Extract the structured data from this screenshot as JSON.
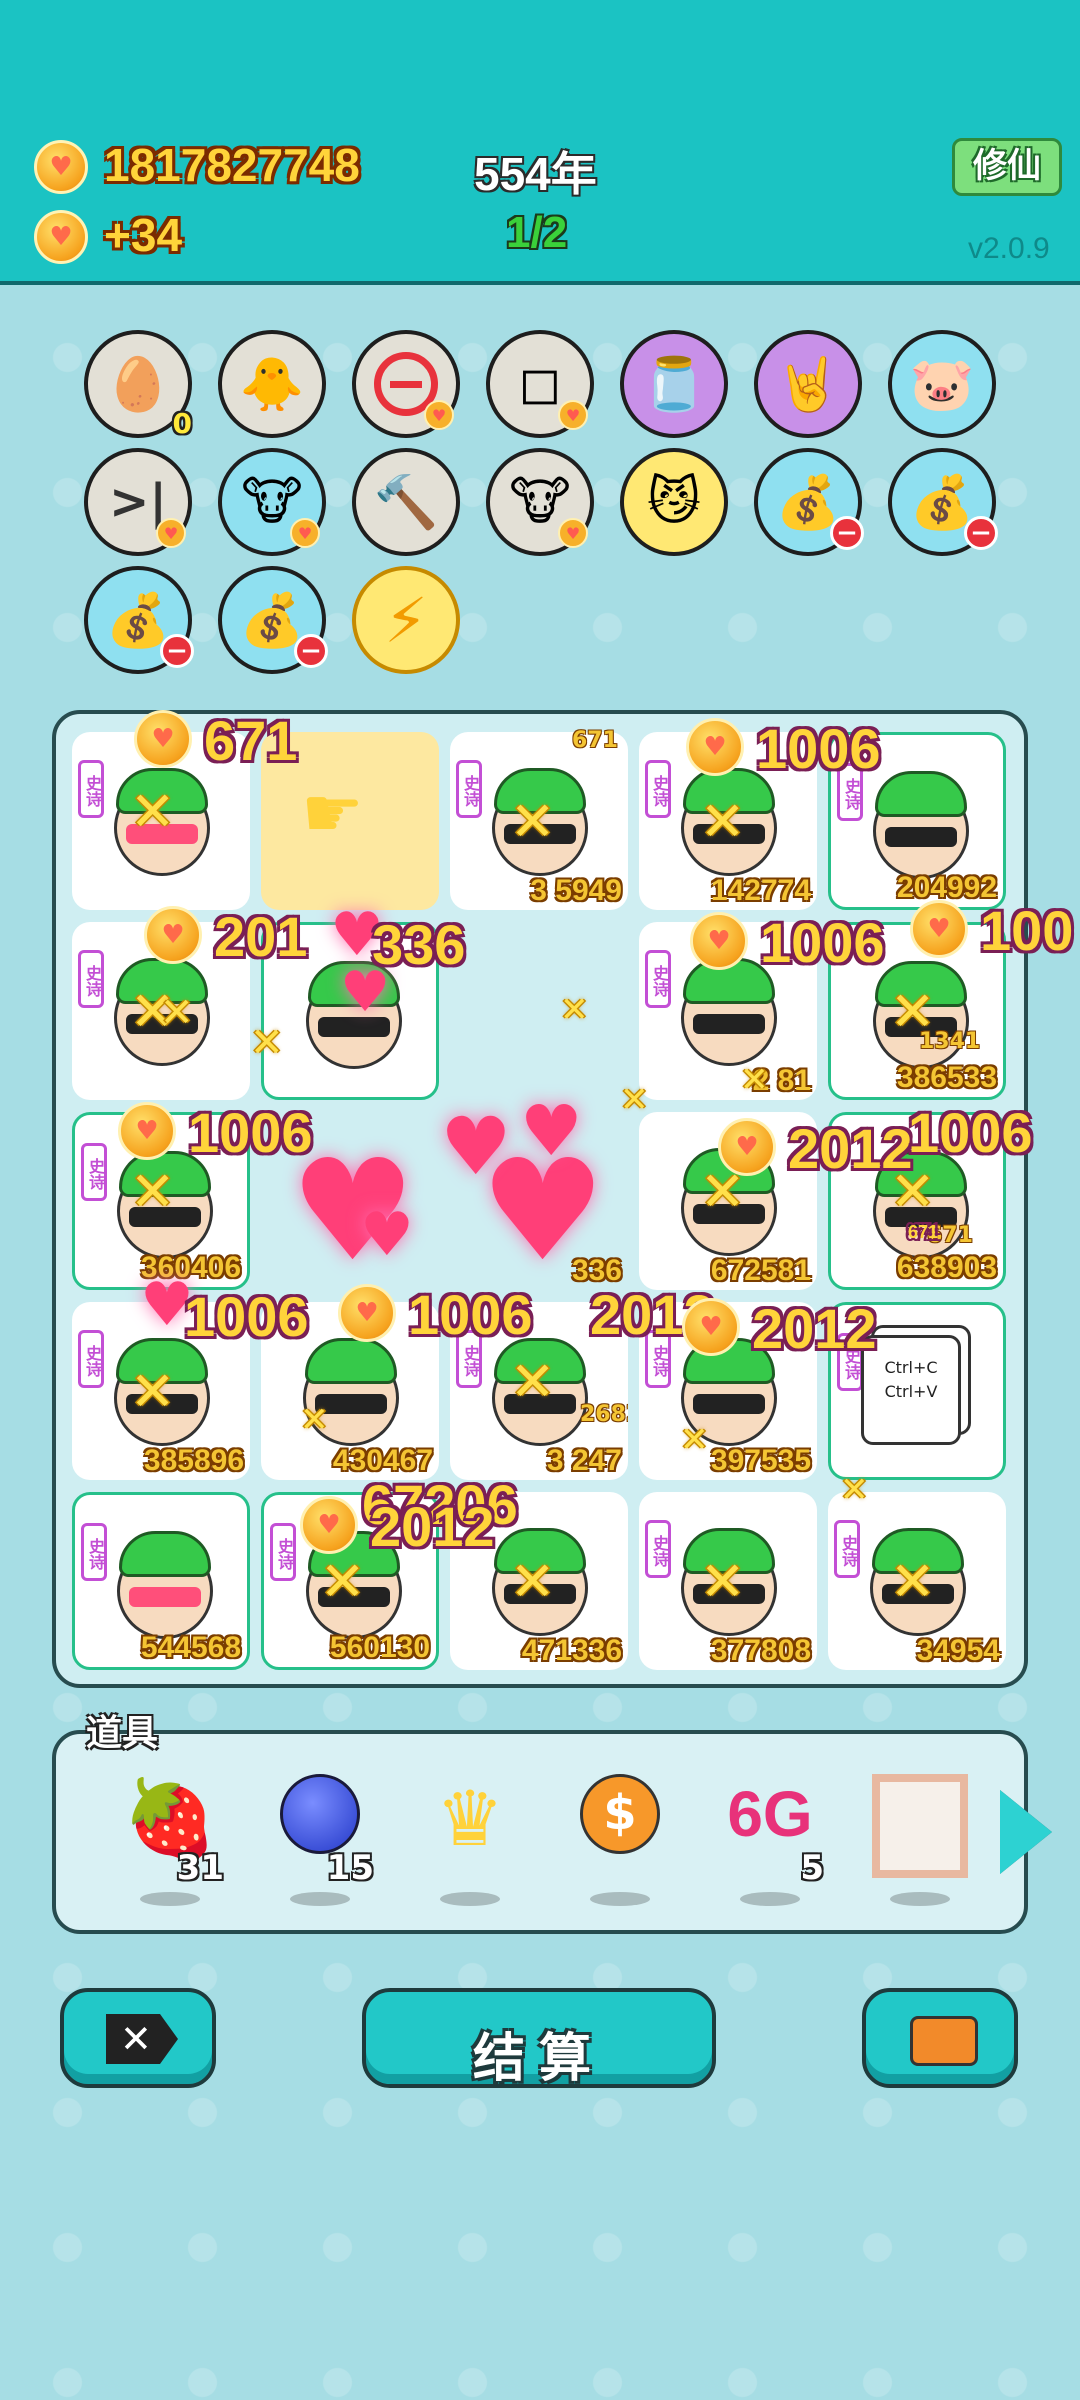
{
  "header": {
    "coins": "1817827748",
    "coins_rate": "+34",
    "year": "554年",
    "progress": "1/2",
    "mode_button": "修仙",
    "version": "v2.0.9"
  },
  "skills": [
    {
      "name": "egg-tray-icon",
      "badge": "0"
    },
    {
      "name": "chick-icon"
    },
    {
      "name": "minus-circle-icon"
    },
    {
      "name": "sugar-cubes-icon"
    },
    {
      "name": "jar-icon"
    },
    {
      "name": "rock-hand-icon"
    },
    {
      "name": "piggy-bank-icon"
    },
    {
      "name": "skip-icon"
    },
    {
      "name": "cows-icon"
    },
    {
      "name": "hammer-icon"
    },
    {
      "name": "cows-icon"
    },
    {
      "name": "cat-glasses-icon"
    },
    {
      "name": "sack-icon"
    },
    {
      "name": "sack-icon"
    },
    {
      "name": "sack-icon"
    },
    {
      "name": "sack-icon"
    },
    {
      "name": "lightning-icon"
    }
  ],
  "board": {
    "tag": "史诗",
    "cells": [
      "",
      "",
      "3 5949",
      "142774",
      "204992",
      "",
      "",
      "",
      "2 81",
      "386533",
      "360406",
      "",
      "336",
      "672581",
      "638903",
      "385896",
      "430467",
      "3 247",
      "397535",
      "",
      "544568",
      "560130",
      "471336",
      "377808",
      "34954"
    ],
    "small_values": [
      "671",
      "1341",
      "671",
      "2682"
    ],
    "ctrl_card": [
      "Ctrl+C",
      "Ctrl+V"
    ],
    "floats": [
      "671",
      "1006",
      "201",
      "336",
      "1006",
      "100",
      "1006",
      "2012",
      "1006",
      "1006",
      "1006",
      "2012",
      "2012",
      "67206",
      "2012",
      "671"
    ]
  },
  "props": {
    "label": "道具",
    "items": [
      {
        "name": "lychee-icon",
        "count": "31"
      },
      {
        "name": "blueberry-icon",
        "count": "15"
      },
      {
        "name": "crown-icon",
        "count": ""
      },
      {
        "name": "dollar-coin-icon",
        "count": ""
      },
      {
        "name": "6g-icon",
        "text": "6G",
        "count": "5"
      },
      {
        "name": "frame-icon",
        "count": ""
      }
    ]
  },
  "buttons": {
    "settle": "结算"
  },
  "colors": {
    "header_bg": "#1bc3c3",
    "page_bg": "#a6dde4",
    "button": "#22c8c8",
    "gold": "#ffd43a"
  }
}
